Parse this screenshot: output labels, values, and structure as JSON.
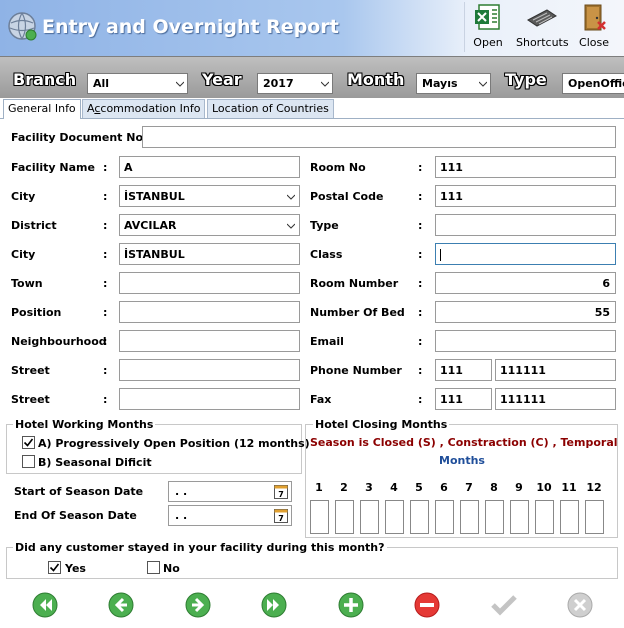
{
  "window": {
    "title": "Entry and Overnight Report",
    "toolbar": {
      "open": "Open",
      "shortcuts": "Shortcuts",
      "close": "Close"
    }
  },
  "filters": {
    "branch_label": "Branch",
    "branch_value": "All",
    "year_label": "Year",
    "year_value": "2017",
    "month_label": "Month",
    "month_value": "Mayıs",
    "type_label": "Type",
    "type_value": "OpenOffice"
  },
  "tabs": [
    "General Info",
    "Accommodation Info",
    "Location of Countries"
  ],
  "form": {
    "doc_no_label": "Facility Document No",
    "doc_no_value": "",
    "left": [
      {
        "label": "Facility Name",
        "value": "A"
      },
      {
        "label": "City",
        "value": "İSTANBUL"
      },
      {
        "label": "District",
        "value": "AVCILAR"
      },
      {
        "label": "City",
        "value": "İSTANBUL"
      },
      {
        "label": "Town",
        "value": ""
      },
      {
        "label": "Position",
        "value": ""
      },
      {
        "label": "Neighbourhood",
        "value": ""
      },
      {
        "label": "Street",
        "value": ""
      },
      {
        "label": "Street",
        "value": ""
      }
    ],
    "right": [
      {
        "label": "Room No",
        "value": "111"
      },
      {
        "label": "Postal Code",
        "value": "111"
      },
      {
        "label": "Type",
        "value": ""
      },
      {
        "label": "Class",
        "value": ""
      },
      {
        "label": "Room Number",
        "value": "6"
      },
      {
        "label": "Number Of Bed",
        "value": "55"
      },
      {
        "label": "Email",
        "value": ""
      },
      {
        "label": "Phone Number",
        "value": "111",
        "value2": "111111"
      },
      {
        "label": "Fax",
        "value": "111",
        "value2": "111111"
      }
    ],
    "colon": ":"
  },
  "working_months": {
    "title": "Hotel Working Months",
    "option_a": "A) Progressively Open Position (12 months)",
    "option_a_checked": true,
    "option_b": "B) Seasonal Dificit",
    "option_b_checked": false,
    "start_label": "Start of Season Date",
    "start_value": ". .",
    "end_label": "End Of Season Date",
    "end_value": ". ."
  },
  "closing_months": {
    "title": "Hotel Closing Months",
    "legend": "Season is Closed (S) , Constraction (C) , Temporal Clos",
    "months_label": "Months",
    "months": [
      "1",
      "2",
      "3",
      "4",
      "5",
      "6",
      "7",
      "8",
      "9",
      "10",
      "11",
      "12"
    ],
    "legend_color": "#8b0000",
    "months_color": "#1f4e9a"
  },
  "customer_question": {
    "title": "Did any customer stayed in your facility during this month?",
    "yes": "Yes",
    "yes_checked": true,
    "no": "No",
    "no_checked": false
  },
  "nav_buttons": [
    "first-icon",
    "previous-icon",
    "next-icon",
    "last-icon",
    "add-icon",
    "delete-icon",
    "confirm-icon",
    "cancel-icon"
  ]
}
